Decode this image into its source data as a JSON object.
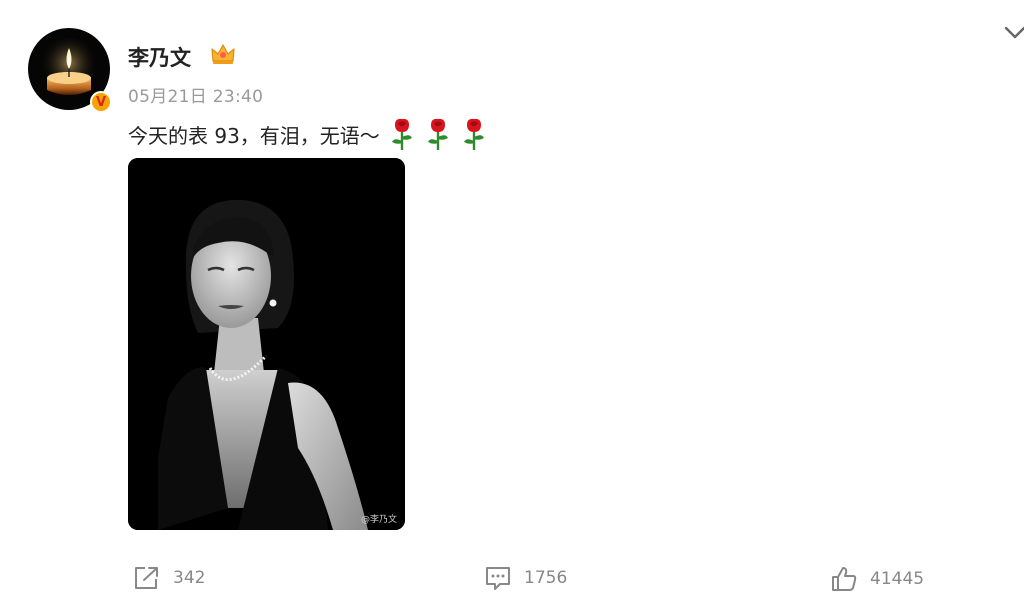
{
  "post": {
    "username": "李乃文",
    "timestamp": "05月21日 23:40",
    "text": "今天的表 93，有泪，无语～",
    "emoji": [
      "rose",
      "rose",
      "rose"
    ],
    "image_watermark": "@李乃文",
    "verified_badge": "V"
  },
  "actions": {
    "repost_count": "342",
    "comment_count": "1756",
    "like_count": "41445"
  },
  "icons": [
    "chevron-down-icon",
    "crown-icon",
    "rose-icon",
    "share-icon",
    "comment-icon",
    "like-icon"
  ],
  "colors": {
    "badge": "#f7a300",
    "rose_red": "#d8141e",
    "leaf_green": "#2e8b2e",
    "muted": "#888888"
  }
}
